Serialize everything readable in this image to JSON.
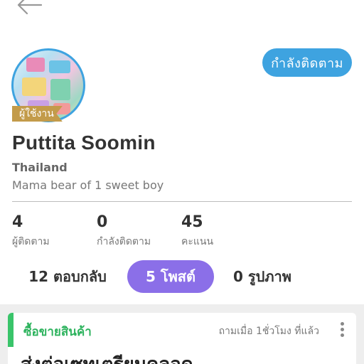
{
  "header": {
    "back_icon": "arrow-left-icon"
  },
  "profile": {
    "follow_button": "กำลังติดตาม",
    "role_badge": "ผู้ใช้งาน",
    "name": "Puttita Soomin",
    "country": "Thailand",
    "bio": "Mama bear of 1 sweet boy"
  },
  "stats": [
    {
      "value": "4",
      "label": "ผู้ติดตาม"
    },
    {
      "value": "0",
      "label": "กำลังติดตาม"
    },
    {
      "value": "45",
      "label": "คะแนน"
    }
  ],
  "tabs": [
    {
      "label": "12 ตอบกลับ",
      "active": false
    },
    {
      "label": "5 โพสต์",
      "active": true
    },
    {
      "label": "0 รูปภาพ",
      "active": false
    }
  ],
  "post": {
    "category": "ซื้อขายสินค้า",
    "time": "ถามเมื่อ 1ชั่วโมง ที่แล้ว",
    "title": "ส่งต่อเซทเตรียมคลอด"
  },
  "colors": {
    "accent_blue": "#3ea3e0",
    "tab_active": "#8b6fe8",
    "category_green": "#39c46a",
    "badge_gold": "#c39b4a"
  }
}
